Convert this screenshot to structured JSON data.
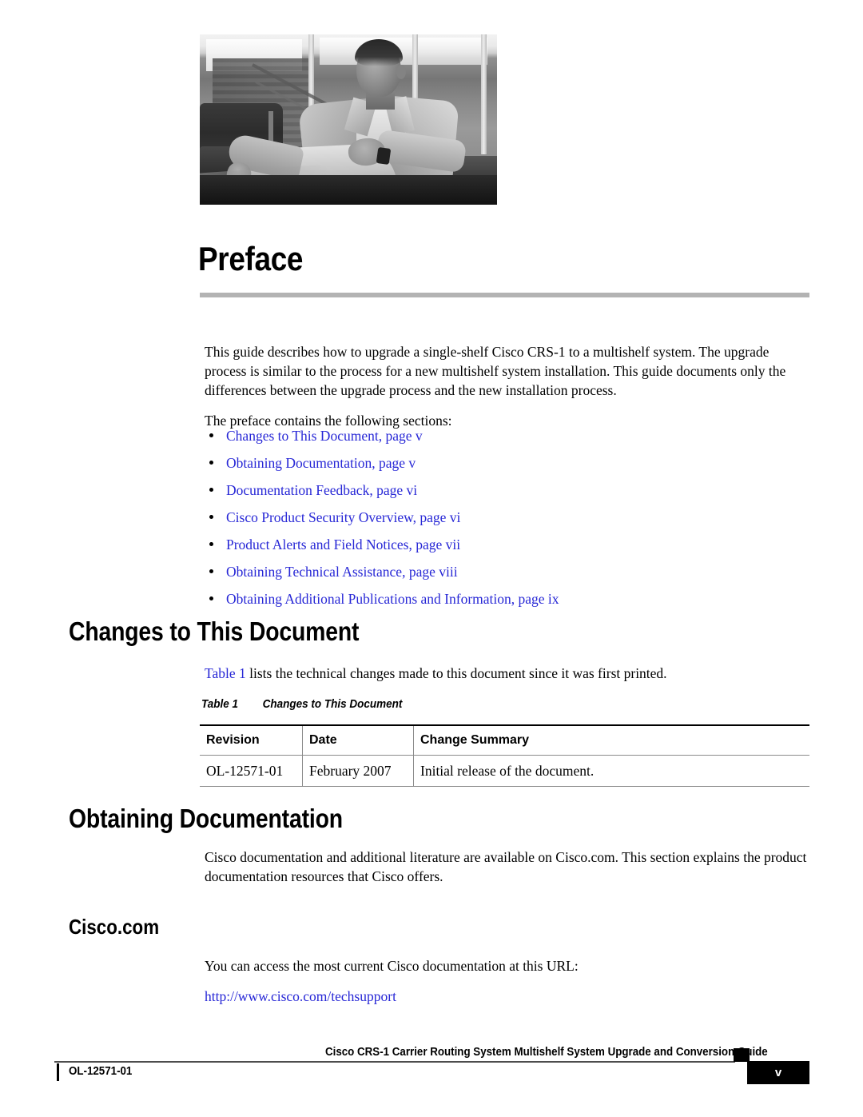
{
  "document": {
    "chapter_title": "Preface",
    "intro_paragraph": "This guide describes how to upgrade a single-shelf Cisco CRS-1 to a multishelf system. The upgrade process is similar to the process for a new multishelf system installation. This guide documents only the differences between the upgrade process and the new installation process.",
    "contains_line": "The preface contains the following sections:"
  },
  "hero_image": {
    "alt": "grayscale photo of a seated man in an office lounge"
  },
  "toc_links": [
    "Changes to This Document, page v",
    "Obtaining Documentation, page v",
    "Documentation Feedback, page vi",
    "Cisco Product Security Overview, page vi",
    "Product Alerts and Field Notices, page vii",
    "Obtaining Technical Assistance, page viii",
    "Obtaining Additional Publications and Information, page ix"
  ],
  "sections": {
    "changes": {
      "heading": "Changes to This Document",
      "intro_link": "Table 1",
      "intro_rest": " lists the technical changes made to this document since it was first printed."
    },
    "obtaining_documentation": {
      "heading": "Obtaining Documentation",
      "paragraph": "Cisco documentation and additional literature are available on Cisco.com. This section explains the product documentation resources that Cisco offers."
    },
    "cisco_com": {
      "heading": "Cisco.com",
      "paragraph": "You can access the most current Cisco documentation at this URL:",
      "url": "http://www.cisco.com/techsupport"
    }
  },
  "table": {
    "caption_label": "Table 1",
    "caption_title": "Changes to This Document",
    "columns": [
      "Revision",
      "Date",
      "Change Summary"
    ],
    "rows": [
      [
        "OL-12571-01",
        "February 2007",
        "Initial release of the document."
      ]
    ]
  },
  "footer": {
    "doc_title": "Cisco CRS-1 Carrier Routing System Multishelf System Upgrade and Conversion Guide",
    "doc_id": "OL-12571-01",
    "page_number": "v"
  },
  "colors": {
    "link": "#2727d6",
    "title_rule": "#b3b3b3",
    "table_rule": "#8a8a8a",
    "text": "#000000"
  }
}
